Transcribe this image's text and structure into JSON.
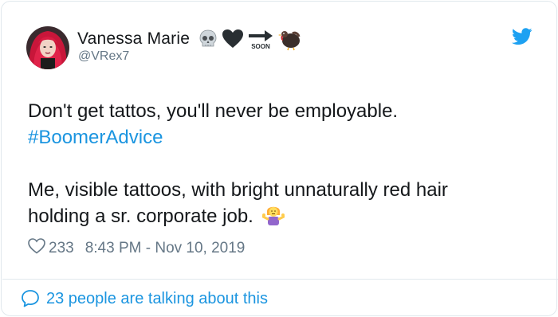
{
  "user": {
    "display_name": "Vanessa Marie",
    "handle": "@VRex7",
    "name_emojis": [
      "skull-icon",
      "black-heart-icon",
      "soon-arrow-icon",
      "turkey-icon"
    ],
    "soon_label": "SOON"
  },
  "tweet": {
    "line1": "Don't get tattos, you'll never be employable.",
    "hashtag": "#BoomerAdvice",
    "line2": "Me, visible tattoos, with bright unnaturally red hair",
    "line3": "holding a sr. corporate job.",
    "end_emoji": "person-shrugging-icon"
  },
  "meta": {
    "like_count": "233",
    "timestamp": "8:43 PM - Nov 10, 2019"
  },
  "footer": {
    "talking_label": "23 people are talking about this"
  },
  "colors": {
    "link": "#1b95e0",
    "secondary": "#657786",
    "border": "#e1e8ed",
    "text": "#14171a"
  }
}
